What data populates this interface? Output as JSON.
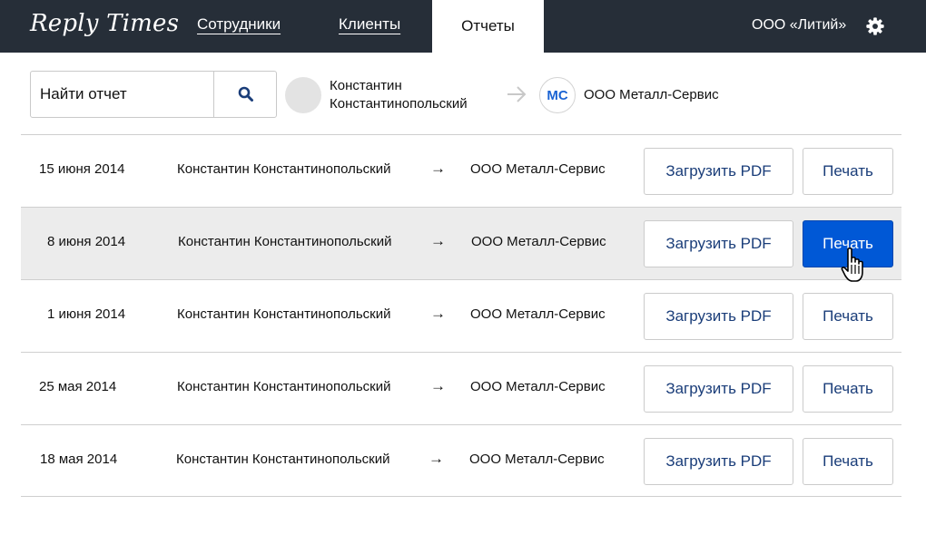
{
  "header": {
    "logo": "Reply Times",
    "nav": [
      {
        "label": "Сотрудники"
      },
      {
        "label": "Клиенты"
      },
      {
        "label": "Отчеты"
      }
    ],
    "company": "ООО «Литий»",
    "settings_icon": "gear-icon"
  },
  "filter": {
    "search_placeholder": "Найти отчет",
    "search_icon": "search-icon",
    "from_name": "Константин Константинопольский",
    "arrow_icon": "arrow-right-icon",
    "to_initials": "МС",
    "to_name": "ООО Металл-Сервис"
  },
  "reports": {
    "rows": [
      {
        "date": "15 июня 2014",
        "from": "Константин Константинопольский",
        "arrow": "→",
        "to": "ООО Металл-Сервис",
        "pdf_label": "Загрузить PDF",
        "print_label": "Печать"
      },
      {
        "date": "8 июня 2014",
        "from": "Константин Константинопольский",
        "arrow": "→",
        "to": "ООО Металл-Сервис",
        "pdf_label": "Загрузить PDF",
        "print_label": "Печать"
      },
      {
        "date": "1 июня 2014",
        "from": "Константин Константинопольский",
        "arrow": "→",
        "to": "ООО Металл-Сервис",
        "pdf_label": "Загрузить PDF",
        "print_label": "Печать"
      },
      {
        "date": "25 мая 2014",
        "from": "Константин Константинопольский",
        "arrow": "→",
        "to": "ООО Металл-Сервис",
        "pdf_label": "Загрузить PDF",
        "print_label": "Печать"
      },
      {
        "date": "18 мая 2014",
        "from": "Константин Константинопольский",
        "arrow": "→",
        "to": "ООО Металл-Сервис",
        "pdf_label": "Загрузить PDF",
        "print_label": "Печать"
      }
    ]
  },
  "colors": {
    "header_bg": "#262e38",
    "accent": "#0058d6",
    "button_text": "#1a3d79",
    "row_hover": "#ececec"
  }
}
